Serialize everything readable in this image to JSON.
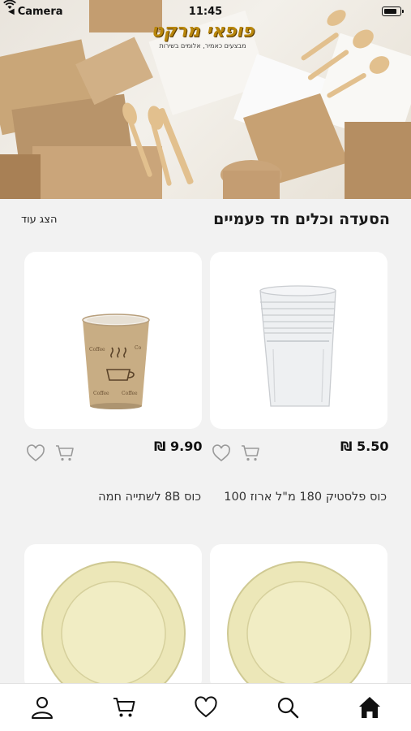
{
  "status_bar": {
    "back_app": "Camera",
    "time": "11:45"
  },
  "brand": {
    "logo_text": "פופאי מרקט",
    "logo_tagline": "מבצעים כאמיר, אלומים בשירות"
  },
  "section": {
    "title": "הסעדה וכלים חד פעמיים",
    "show_more": "הצג עוד"
  },
  "products": [
    {
      "name": "כוס פלסטיק 180 מ\"ל ארוז 100",
      "price": "₪ 5.50",
      "image": "plastic-cups-stack"
    },
    {
      "name": "כוס 8B לשתייה חמה",
      "price": "₪ 9.90",
      "image": "paper-coffee-cup"
    },
    {
      "name": "",
      "price": "",
      "image": "cream-plate"
    },
    {
      "name": "",
      "price": "",
      "image": "cream-plate"
    }
  ],
  "tabs": [
    {
      "icon": "home-icon",
      "active": true
    },
    {
      "icon": "search-icon"
    },
    {
      "icon": "heart-icon"
    },
    {
      "icon": "cart-icon"
    },
    {
      "icon": "user-icon"
    }
  ],
  "colors": {
    "background": "#f2f2f2",
    "card": "#ffffff",
    "text": "#222222",
    "icon_outline": "#9a9a9a",
    "brand_gold": "#b8860b"
  }
}
